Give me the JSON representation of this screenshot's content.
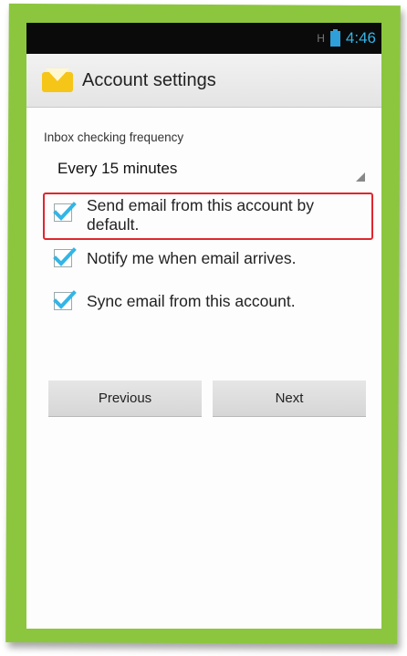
{
  "statusbar": {
    "signal": "H",
    "time": "4:46"
  },
  "actionbar": {
    "title": "Account settings"
  },
  "form": {
    "frequency_label": "Inbox checking frequency",
    "frequency_value": "Every 15 minutes",
    "options": [
      {
        "label": "Send email from this account by default.",
        "checked": true
      },
      {
        "label": "Notify me when email arrives.",
        "checked": true
      },
      {
        "label": "Sync email from this account.",
        "checked": true
      }
    ]
  },
  "buttons": {
    "previous": "Previous",
    "next": "Next"
  },
  "colors": {
    "frame": "#8cc63f",
    "accent": "#33b5e5",
    "highlight": "#e0262e",
    "check": "#33b5e5"
  }
}
